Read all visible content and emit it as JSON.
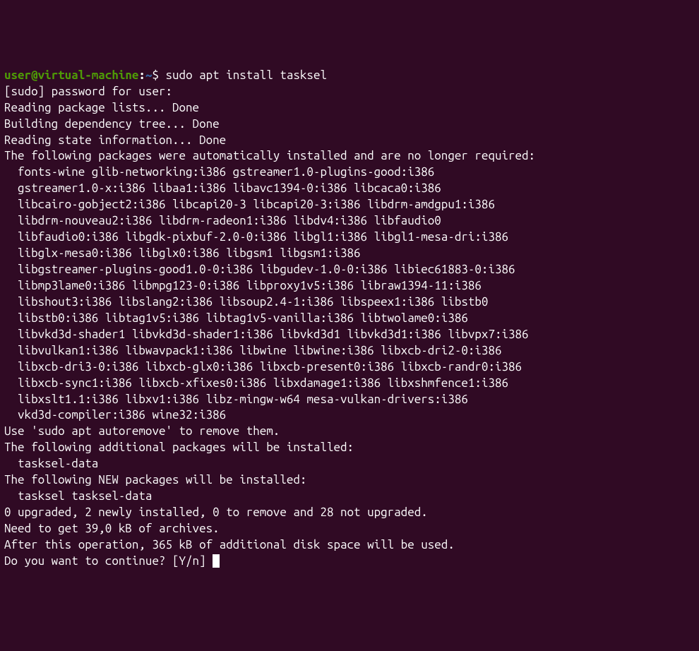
{
  "prompt": {
    "user_host": "user@virtual-machine",
    "colon": ":",
    "path": "~",
    "dollar": "$ ",
    "command": "sudo apt install tasksel"
  },
  "lines": {
    "l0": "[sudo] password for user:",
    "l1": "Reading package lists... Done",
    "l2": "Building dependency tree... Done",
    "l3": "Reading state information... Done",
    "l4": "The following packages were automatically installed and are no longer required:",
    "l5": "  fonts-wine glib-networking:i386 gstreamer1.0-plugins-good:i386",
    "l6": "  gstreamer1.0-x:i386 libaa1:i386 libavc1394-0:i386 libcaca0:i386",
    "l7": "  libcairo-gobject2:i386 libcapi20-3 libcapi20-3:i386 libdrm-amdgpu1:i386",
    "l8": "  libdrm-nouveau2:i386 libdrm-radeon1:i386 libdv4:i386 libfaudio0",
    "l9": "  libfaudio0:i386 libgdk-pixbuf-2.0-0:i386 libgl1:i386 libgl1-mesa-dri:i386",
    "l10": "  libglx-mesa0:i386 libglx0:i386 libgsm1 libgsm1:i386",
    "l11": "  libgstreamer-plugins-good1.0-0:i386 libgudev-1.0-0:i386 libiec61883-0:i386",
    "l12": "  libmp3lame0:i386 libmpg123-0:i386 libproxy1v5:i386 libraw1394-11:i386",
    "l13": "  libshout3:i386 libslang2:i386 libsoup2.4-1:i386 libspeex1:i386 libstb0",
    "l14": "  libstb0:i386 libtag1v5:i386 libtag1v5-vanilla:i386 libtwolame0:i386",
    "l15": "  libvkd3d-shader1 libvkd3d-shader1:i386 libvkd3d1 libvkd3d1:i386 libvpx7:i386",
    "l16": "  libvulkan1:i386 libwavpack1:i386 libwine libwine:i386 libxcb-dri2-0:i386",
    "l17": "  libxcb-dri3-0:i386 libxcb-glx0:i386 libxcb-present0:i386 libxcb-randr0:i386",
    "l18": "  libxcb-sync1:i386 libxcb-xfixes0:i386 libxdamage1:i386 libxshmfence1:i386",
    "l19": "  libxslt1.1:i386 libxv1:i386 libz-mingw-w64 mesa-vulkan-drivers:i386",
    "l20": "  vkd3d-compiler:i386 wine32:i386",
    "l21": "Use 'sudo apt autoremove' to remove them.",
    "l22": "The following additional packages will be installed:",
    "l23": "  tasksel-data",
    "l24": "The following NEW packages will be installed:",
    "l25": "  tasksel tasksel-data",
    "l26": "0 upgraded, 2 newly installed, 0 to remove and 28 not upgraded.",
    "l27": "Need to get 39,0 kB of archives.",
    "l28": "After this operation, 365 kB of additional disk space will be used.",
    "l29": "Do you want to continue? [Y/n] "
  }
}
